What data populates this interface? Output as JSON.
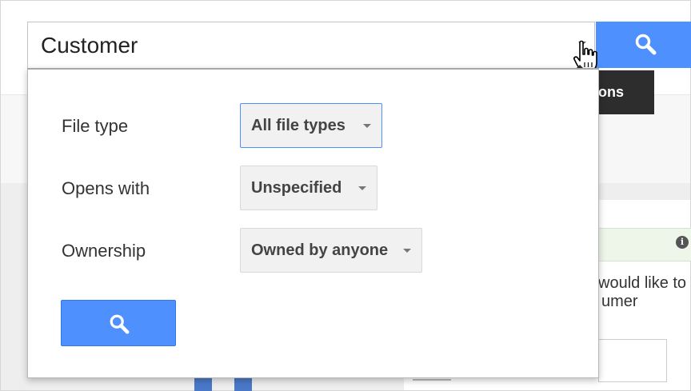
{
  "search": {
    "value": "Customer",
    "options_tooltip": "Search options"
  },
  "options": {
    "file_type": {
      "label": "File type",
      "value": "All file types"
    },
    "opens_with": {
      "label": "Opens with",
      "value": "Unspecified"
    },
    "ownership": {
      "label": "Ownership",
      "value": "Owned by anyone"
    }
  },
  "background": {
    "partial_text_line1": "would like to",
    "partial_text_line2": "umer",
    "info_icon_glyph": "i"
  },
  "colors": {
    "accent_blue": "#4d90fe",
    "tooltip_bg": "#2d2d2d"
  },
  "icons": {
    "search_button": "search-icon",
    "options_toggle": "chevron-down-icon",
    "cursor": "hand-pointer-icon",
    "info": "info-icon"
  }
}
